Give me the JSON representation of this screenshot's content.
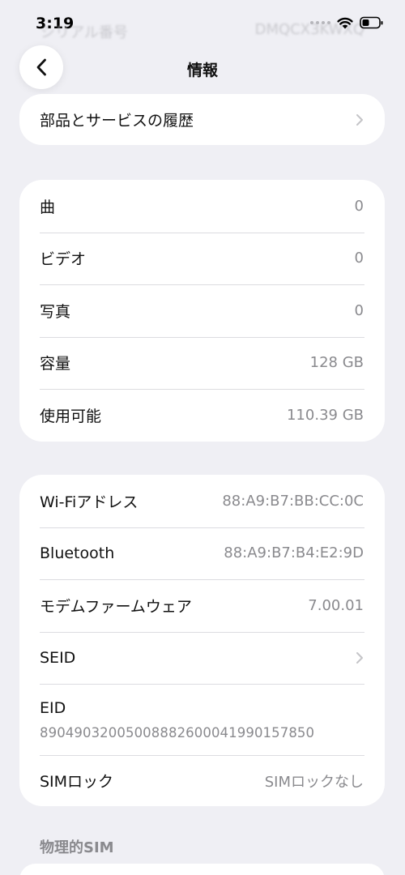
{
  "status": {
    "time": "3:19"
  },
  "ghost_header": {
    "left": "シリアル番号",
    "right": "DMQCX3KWXQ"
  },
  "nav": {
    "title": "情報"
  },
  "history": {
    "label": "部品とサービスの履歴"
  },
  "media": [
    {
      "label": "曲",
      "value": "0"
    },
    {
      "label": "ビデオ",
      "value": "0"
    },
    {
      "label": "写真",
      "value": "0"
    },
    {
      "label": "容量",
      "value": "128 GB"
    },
    {
      "label": "使用可能",
      "value": "110.39 GB"
    }
  ],
  "network": {
    "wifi": {
      "label": "Wi-Fiアドレス",
      "value": "88:A9:B7:BB:CC:0C"
    },
    "bluetooth": {
      "label": "Bluetooth",
      "value": "88:A9:B7:B4:E2:9D"
    },
    "modem": {
      "label": "モデムファームウェア",
      "value": "7.00.01"
    },
    "seid": {
      "label": "SEID"
    },
    "eid": {
      "label": "EID",
      "value": "89049032005008882600041990157850"
    },
    "sim_lock": {
      "label": "SIMロック",
      "value": "SIMロックなし"
    }
  },
  "physical_sim": {
    "header": "物理的SIM"
  },
  "colors": {
    "background": "#efeff4",
    "card": "#ffffff",
    "secondary_text": "#8a8a8e",
    "separator": "#dcdce0",
    "chevron": "#c4c4c7"
  },
  "icons": [
    "back-chevron-icon",
    "wifi-icon",
    "battery-icon",
    "chevron-right-icon"
  ]
}
